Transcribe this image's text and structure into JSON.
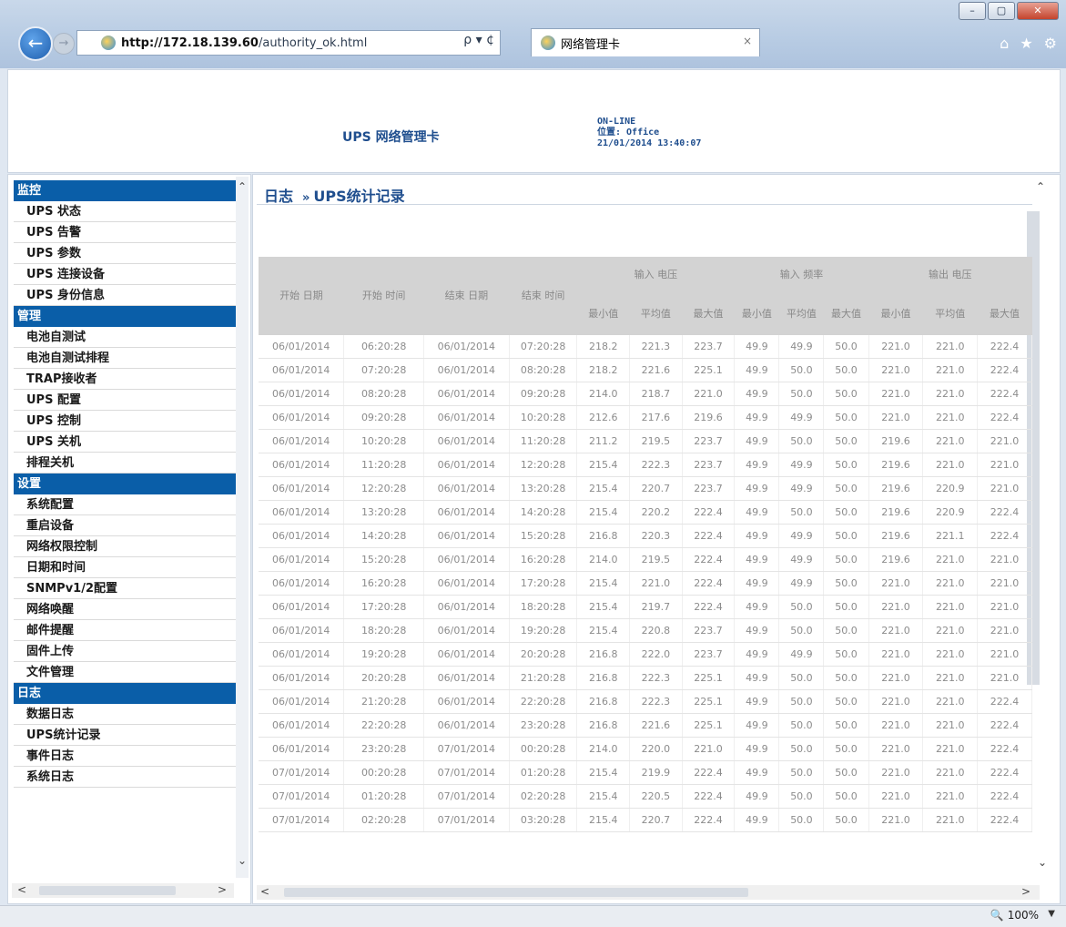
{
  "browser": {
    "url_host": "http://172.18.139.60",
    "url_path": "/authority_ok.html",
    "address_tools": "ρ ▾ ¢",
    "tab_title": "网络管理卡",
    "tab_close": "×",
    "window_buttons": [
      "–",
      "▢",
      "✕"
    ],
    "toolbar_icons": [
      "home-icon",
      "star-icon",
      "gear-icon"
    ],
    "zoom": "100%"
  },
  "header": {
    "brand": "UPS 网络管理卡",
    "status": "ON-LINE",
    "location": "位置: Office",
    "datetime": "21/01/2014 13:40:07"
  },
  "sidebar": {
    "sections": [
      {
        "title": "监控",
        "items": [
          "UPS 状态",
          "UPS 告警",
          "UPS 参数",
          "UPS 连接设备",
          "UPS 身份信息"
        ]
      },
      {
        "title": "管理",
        "items": [
          "电池自测试",
          "电池自测试排程",
          "TRAP接收者",
          "UPS 配置",
          "UPS 控制",
          "UPS 关机",
          "排程关机"
        ]
      },
      {
        "title": "设置",
        "items": [
          "系统配置",
          "重启设备",
          "网络权限控制",
          "日期和时间",
          "SNMPv1/2配置",
          "网络唤醒",
          "邮件提醒",
          "固件上传",
          "文件管理"
        ]
      },
      {
        "title": "日志",
        "items": [
          "数据日志",
          "UPS统计记录",
          "事件日志",
          "系统日志"
        ]
      }
    ]
  },
  "content": {
    "breadcrumb_root": "日志",
    "breadcrumb_sep": "»",
    "breadcrumb_page": "UPS统计记录",
    "table": {
      "headers": {
        "start_date": "开始 日期",
        "start_time": "开始 时间",
        "end_date": "结束 日期",
        "end_time": "结束 时间",
        "in_voltage": "输入 电压",
        "in_freq": "输入 频率",
        "out_voltage": "输出 电压",
        "min": "最小值",
        "avg": "平均值",
        "max": "最大值"
      },
      "rows": [
        [
          "06/01/2014",
          "06:20:28",
          "06/01/2014",
          "07:20:28",
          "218.2",
          "221.3",
          "223.7",
          "49.9",
          "49.9",
          "50.0",
          "221.0",
          "221.0",
          "222.4"
        ],
        [
          "06/01/2014",
          "07:20:28",
          "06/01/2014",
          "08:20:28",
          "218.2",
          "221.6",
          "225.1",
          "49.9",
          "50.0",
          "50.0",
          "221.0",
          "221.0",
          "222.4"
        ],
        [
          "06/01/2014",
          "08:20:28",
          "06/01/2014",
          "09:20:28",
          "214.0",
          "218.7",
          "221.0",
          "49.9",
          "50.0",
          "50.0",
          "221.0",
          "221.0",
          "222.4"
        ],
        [
          "06/01/2014",
          "09:20:28",
          "06/01/2014",
          "10:20:28",
          "212.6",
          "217.6",
          "219.6",
          "49.9",
          "49.9",
          "50.0",
          "221.0",
          "221.0",
          "222.4"
        ],
        [
          "06/01/2014",
          "10:20:28",
          "06/01/2014",
          "11:20:28",
          "211.2",
          "219.5",
          "223.7",
          "49.9",
          "50.0",
          "50.0",
          "219.6",
          "221.0",
          "221.0"
        ],
        [
          "06/01/2014",
          "11:20:28",
          "06/01/2014",
          "12:20:28",
          "215.4",
          "222.3",
          "223.7",
          "49.9",
          "49.9",
          "50.0",
          "219.6",
          "221.0",
          "221.0"
        ],
        [
          "06/01/2014",
          "12:20:28",
          "06/01/2014",
          "13:20:28",
          "215.4",
          "220.7",
          "223.7",
          "49.9",
          "49.9",
          "50.0",
          "219.6",
          "220.9",
          "221.0"
        ],
        [
          "06/01/2014",
          "13:20:28",
          "06/01/2014",
          "14:20:28",
          "215.4",
          "220.2",
          "222.4",
          "49.9",
          "50.0",
          "50.0",
          "219.6",
          "220.9",
          "222.4"
        ],
        [
          "06/01/2014",
          "14:20:28",
          "06/01/2014",
          "15:20:28",
          "216.8",
          "220.3",
          "222.4",
          "49.9",
          "49.9",
          "50.0",
          "219.6",
          "221.1",
          "222.4"
        ],
        [
          "06/01/2014",
          "15:20:28",
          "06/01/2014",
          "16:20:28",
          "214.0",
          "219.5",
          "222.4",
          "49.9",
          "49.9",
          "50.0",
          "219.6",
          "221.0",
          "221.0"
        ],
        [
          "06/01/2014",
          "16:20:28",
          "06/01/2014",
          "17:20:28",
          "215.4",
          "221.0",
          "222.4",
          "49.9",
          "49.9",
          "50.0",
          "221.0",
          "221.0",
          "221.0"
        ],
        [
          "06/01/2014",
          "17:20:28",
          "06/01/2014",
          "18:20:28",
          "215.4",
          "219.7",
          "222.4",
          "49.9",
          "50.0",
          "50.0",
          "221.0",
          "221.0",
          "221.0"
        ],
        [
          "06/01/2014",
          "18:20:28",
          "06/01/2014",
          "19:20:28",
          "215.4",
          "220.8",
          "223.7",
          "49.9",
          "50.0",
          "50.0",
          "221.0",
          "221.0",
          "221.0"
        ],
        [
          "06/01/2014",
          "19:20:28",
          "06/01/2014",
          "20:20:28",
          "216.8",
          "222.0",
          "223.7",
          "49.9",
          "49.9",
          "50.0",
          "221.0",
          "221.0",
          "221.0"
        ],
        [
          "06/01/2014",
          "20:20:28",
          "06/01/2014",
          "21:20:28",
          "216.8",
          "222.3",
          "225.1",
          "49.9",
          "50.0",
          "50.0",
          "221.0",
          "221.0",
          "221.0"
        ],
        [
          "06/01/2014",
          "21:20:28",
          "06/01/2014",
          "22:20:28",
          "216.8",
          "222.3",
          "225.1",
          "49.9",
          "50.0",
          "50.0",
          "221.0",
          "221.0",
          "222.4"
        ],
        [
          "06/01/2014",
          "22:20:28",
          "06/01/2014",
          "23:20:28",
          "216.8",
          "221.6",
          "225.1",
          "49.9",
          "50.0",
          "50.0",
          "221.0",
          "221.0",
          "222.4"
        ],
        [
          "06/01/2014",
          "23:20:28",
          "07/01/2014",
          "00:20:28",
          "214.0",
          "220.0",
          "221.0",
          "49.9",
          "50.0",
          "50.0",
          "221.0",
          "221.0",
          "222.4"
        ],
        [
          "07/01/2014",
          "00:20:28",
          "07/01/2014",
          "01:20:28",
          "215.4",
          "219.9",
          "222.4",
          "49.9",
          "50.0",
          "50.0",
          "221.0",
          "221.0",
          "222.4"
        ],
        [
          "07/01/2014",
          "01:20:28",
          "07/01/2014",
          "02:20:28",
          "215.4",
          "220.5",
          "222.4",
          "49.9",
          "50.0",
          "50.0",
          "221.0",
          "221.0",
          "222.4"
        ],
        [
          "07/01/2014",
          "02:20:28",
          "07/01/2014",
          "03:20:28",
          "215.4",
          "220.7",
          "222.4",
          "49.9",
          "50.0",
          "50.0",
          "221.0",
          "221.0",
          "222.4"
        ]
      ]
    }
  },
  "colors": {
    "sidebar_header_bg": "#0a5ea8",
    "brand_text": "#1f4e8e",
    "table_header_bg": "#d3d3d3"
  }
}
